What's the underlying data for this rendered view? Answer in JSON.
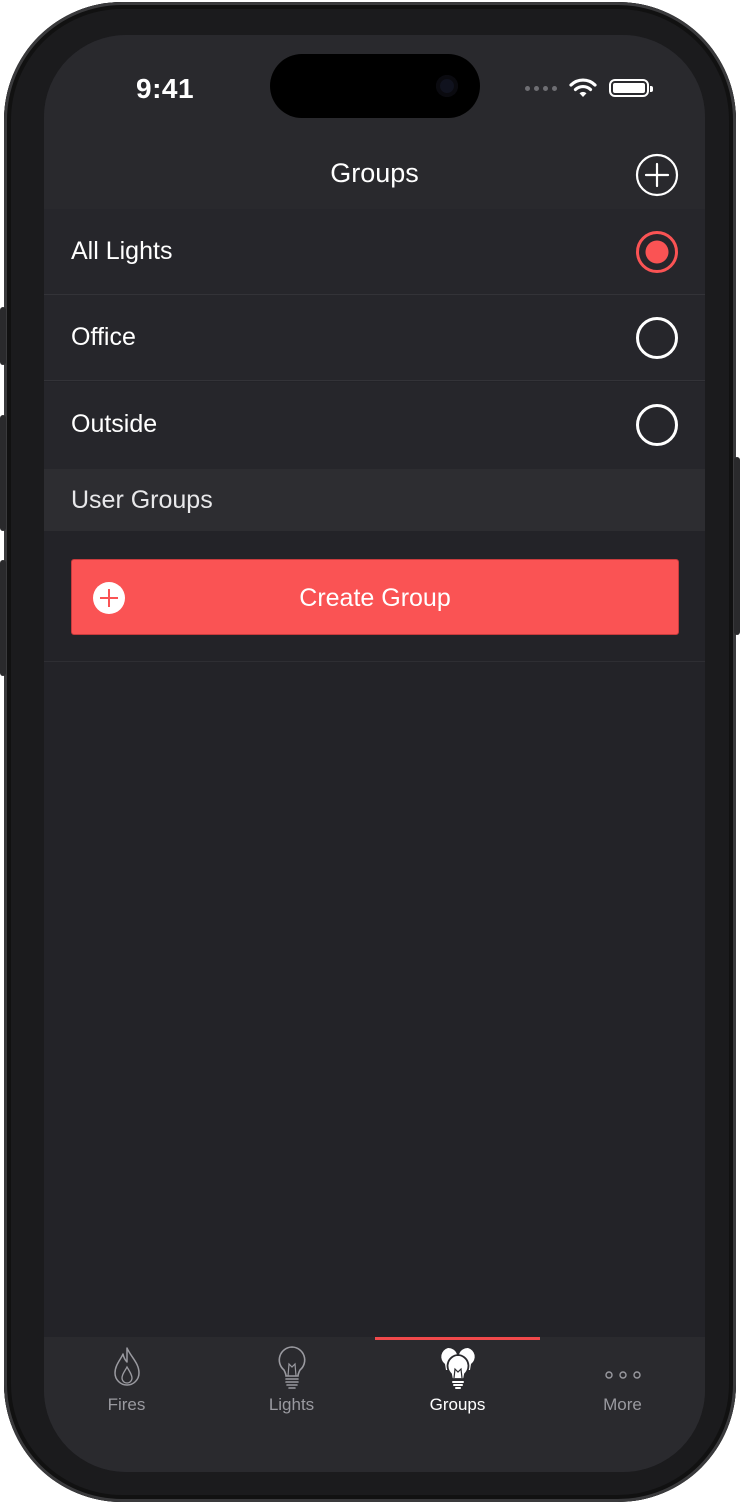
{
  "status_bar": {
    "time": "9:41"
  },
  "nav": {
    "title": "Groups",
    "add_icon": "plus-circle-icon"
  },
  "groups": [
    {
      "label": "All Lights",
      "selected": true
    },
    {
      "label": "Office",
      "selected": false
    },
    {
      "label": "Outside",
      "selected": false
    }
  ],
  "section": {
    "label": "User Groups"
  },
  "create_button": {
    "label": "Create Group",
    "icon": "plus-circle-icon"
  },
  "tabs": [
    {
      "label": "Fires",
      "icon": "flame-icon",
      "active": false
    },
    {
      "label": "Lights",
      "icon": "lightbulb-icon",
      "active": false
    },
    {
      "label": "Groups",
      "icon": "lightbulbs-group-icon",
      "active": true
    },
    {
      "label": "More",
      "icon": "more-dots-icon",
      "active": false
    }
  ],
  "colors": {
    "accent": "#fa5354",
    "background": "#232328",
    "bar": "#29292d"
  }
}
